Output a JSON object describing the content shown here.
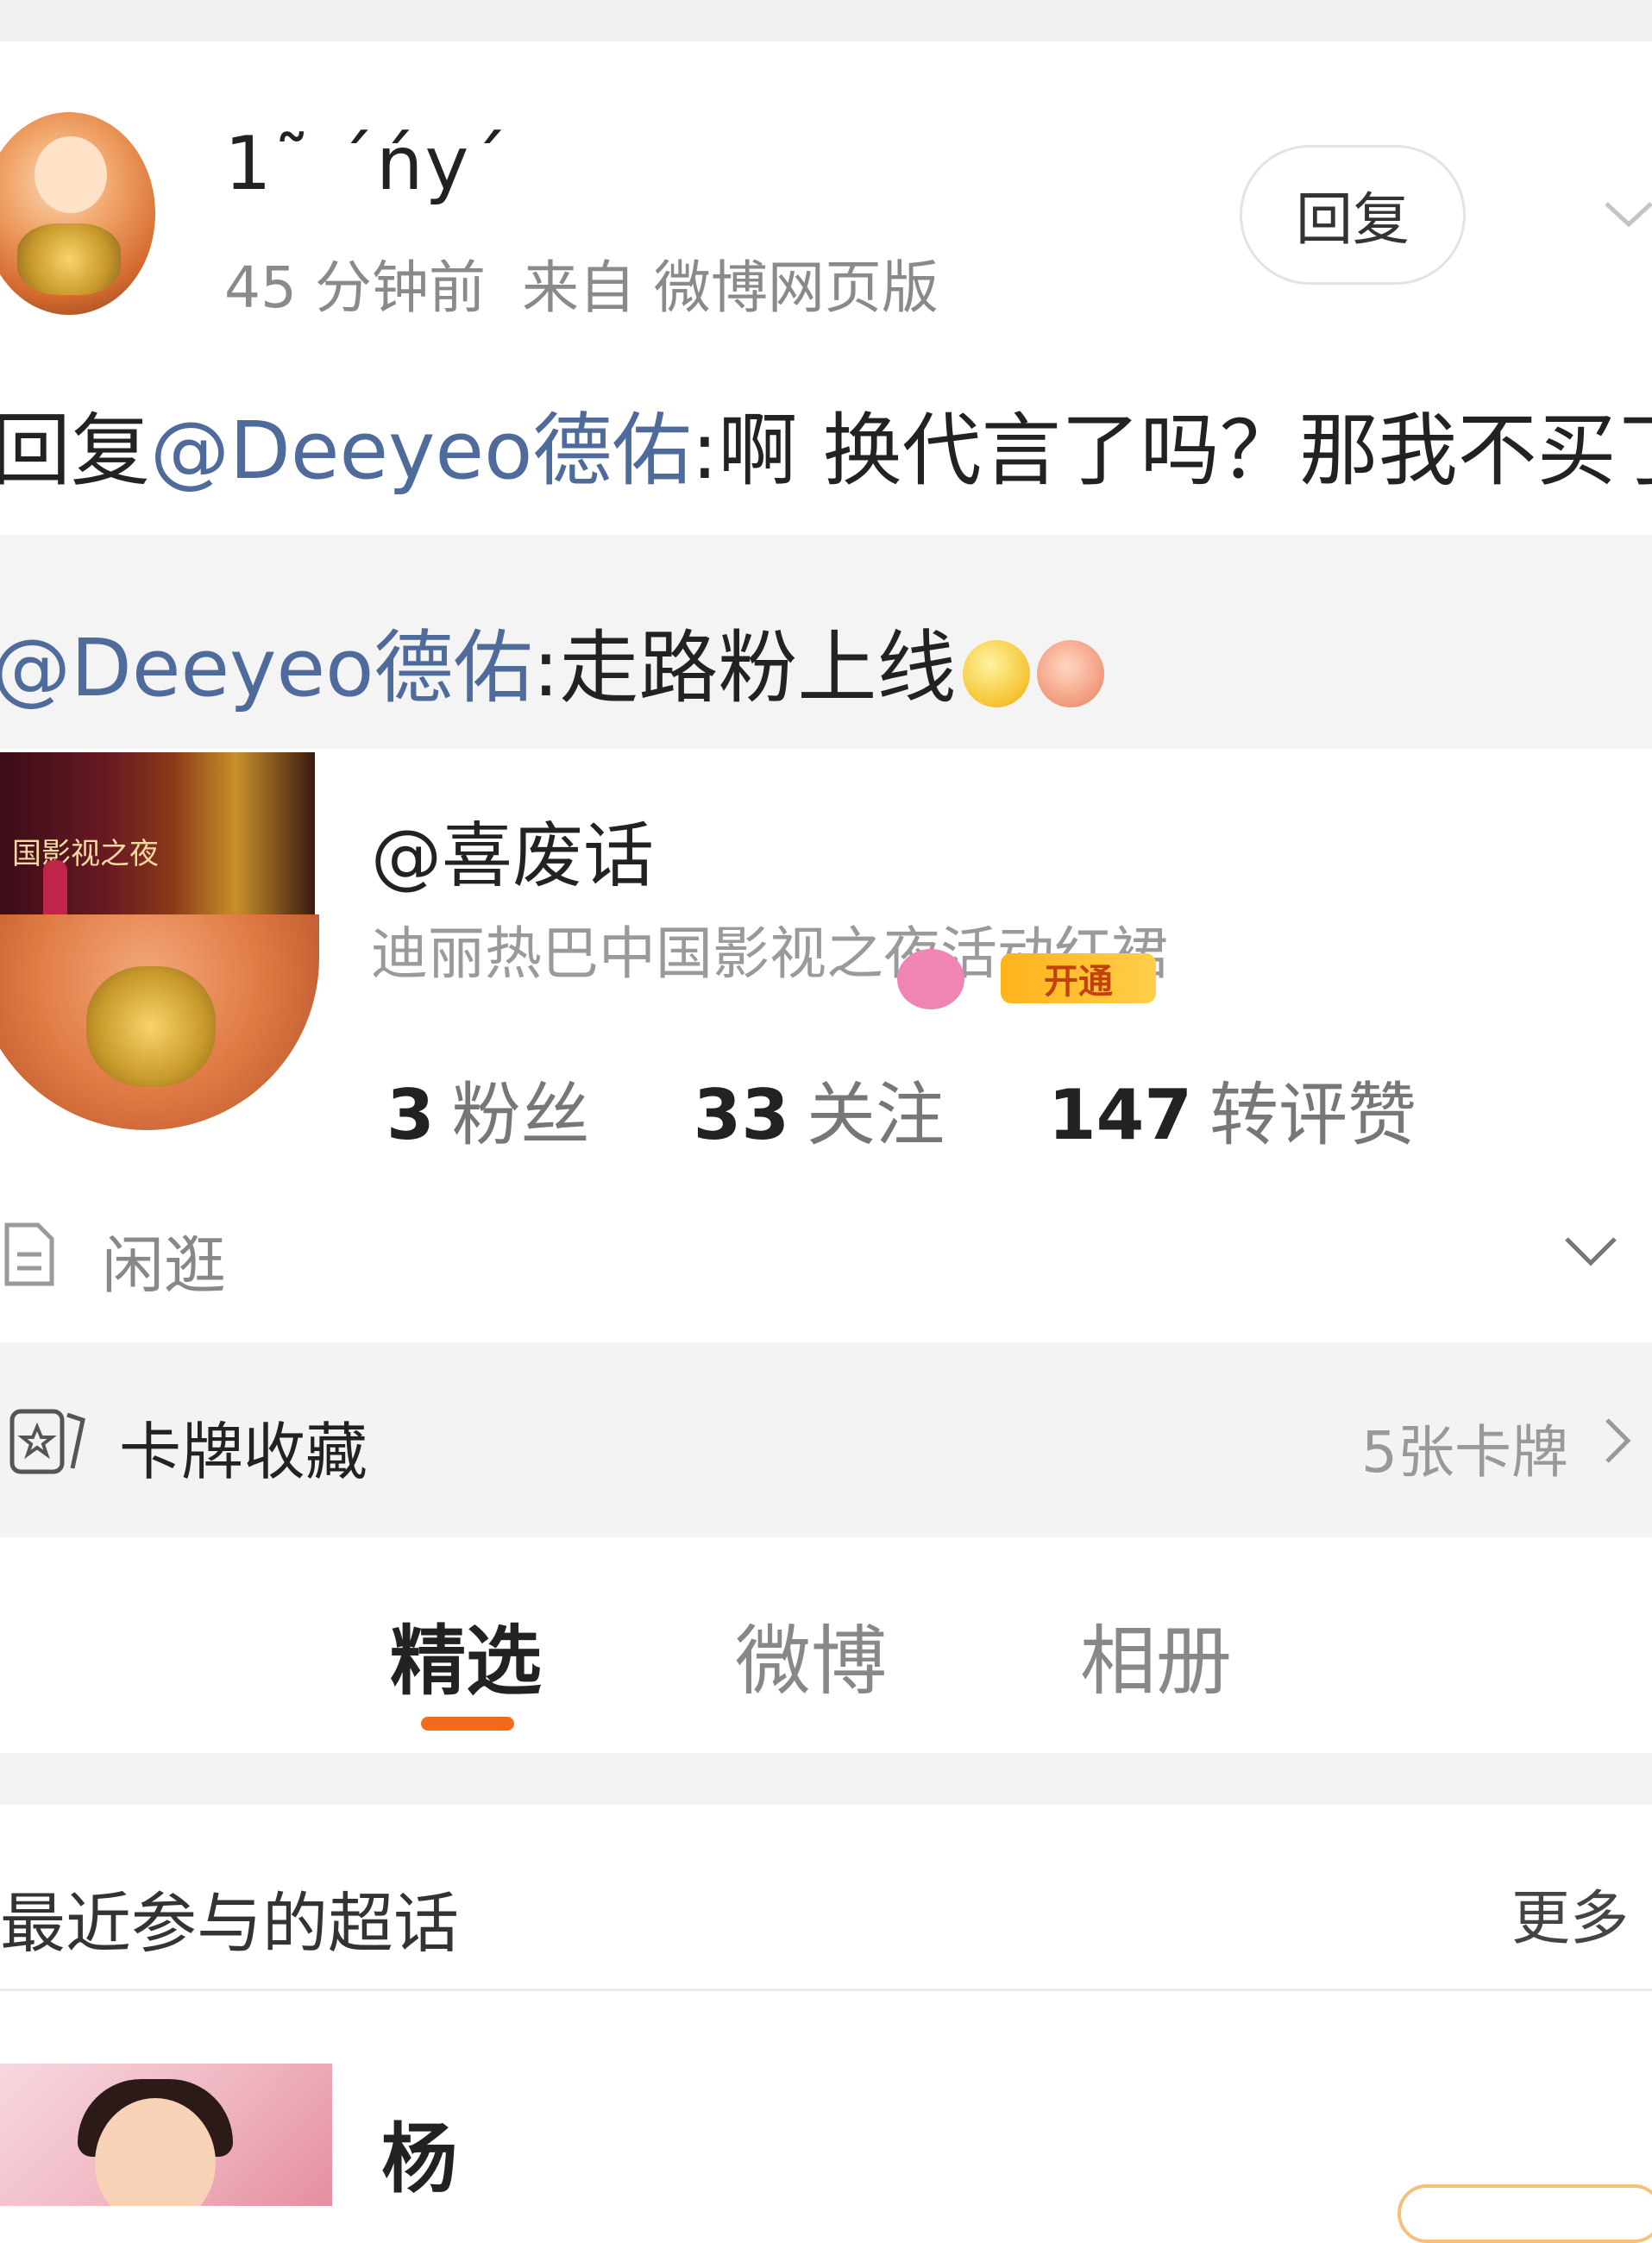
{
  "comment": {
    "username": "1˜   ˊńуˊ",
    "time": "45 分钟前",
    "source": "来自 微博网页版",
    "reply_button": "回复",
    "reply_prefix": "回复",
    "reply_mention": "@Deeyeo德佑",
    "reply_body": ":啊 换代言了吗？那我不买了"
  },
  "quoted": {
    "mention": "@Deeyeo德佑",
    "body": ":走路粉上线",
    "emojis": [
      "grin-emoji",
      "blob-emoji"
    ]
  },
  "linked_post": {
    "poster_text": "国影视之夜",
    "author": "@喜废话",
    "summary": "迪丽热巴中国影视之夜活动红裙"
  },
  "profile": {
    "vip_open_label": "开通",
    "stats": [
      {
        "value": "3",
        "label": "粉丝"
      },
      {
        "value": "33",
        "label": "关注"
      },
      {
        "value": "147",
        "label": "转评赞"
      }
    ],
    "intro": "闲逛"
  },
  "cards_section": {
    "title": "卡牌收藏",
    "count": "5张卡牌"
  },
  "tabs": [
    {
      "label": "精选",
      "active": true
    },
    {
      "label": "微博",
      "active": false
    },
    {
      "label": "相册",
      "active": false
    }
  ],
  "super_topics": {
    "title": "最近参与的超话",
    "more": "更多",
    "items": [
      {
        "name": "杨"
      }
    ]
  },
  "colors": {
    "mention": "#4f6b9c",
    "tab_accent": "#f26a1b",
    "muted": "#8a8a8a"
  }
}
